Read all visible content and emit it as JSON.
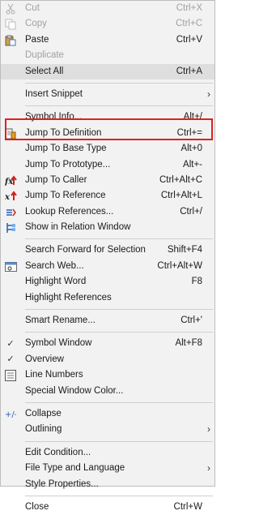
{
  "menu": {
    "cut": {
      "label": "Cut",
      "shortcut": "Ctrl+X",
      "icon": "scissors-icon"
    },
    "copy": {
      "label": "Copy",
      "shortcut": "Ctrl+C",
      "icon": "copy-icon"
    },
    "paste": {
      "label": "Paste",
      "shortcut": "Ctrl+V",
      "icon": "paste-icon"
    },
    "duplicate": {
      "label": "Duplicate",
      "shortcut": ""
    },
    "select_all": {
      "label": "Select All",
      "shortcut": "Ctrl+A"
    },
    "insert_snippet": {
      "label": "Insert Snippet",
      "submenu": "›"
    },
    "symbol_info": {
      "label": "Symbol Info...",
      "shortcut": "Alt+/"
    },
    "jump_definition": {
      "label": "Jump To Definition",
      "shortcut": "Ctrl+=",
      "icon": "jump-definition-icon"
    },
    "jump_base": {
      "label": "Jump To Base Type",
      "shortcut": "Alt+0"
    },
    "jump_prototype": {
      "label": "Jump To Prototype...",
      "shortcut": "Alt+-"
    },
    "jump_caller": {
      "label": "Jump To Caller",
      "shortcut": "Ctrl+Alt+C",
      "icon": "jump-caller-icon"
    },
    "jump_reference": {
      "label": "Jump To Reference",
      "shortcut": "Ctrl+Alt+L",
      "icon": "jump-reference-icon"
    },
    "lookup_refs": {
      "label": "Lookup References...",
      "shortcut": "Ctrl+/",
      "icon": "lookup-references-icon"
    },
    "relation_window": {
      "label": "Show in Relation Window",
      "shortcut": "",
      "icon": "relation-window-icon"
    },
    "search_forward": {
      "label": "Search Forward for Selection",
      "shortcut": "Shift+F4"
    },
    "search_web": {
      "label": "Search Web...",
      "shortcut": "Ctrl+Alt+W",
      "icon": "search-web-icon"
    },
    "highlight_word": {
      "label": "Highlight Word",
      "shortcut": "F8"
    },
    "highlight_refs": {
      "label": "Highlight References",
      "shortcut": ""
    },
    "smart_rename": {
      "label": "Smart Rename...",
      "shortcut": "Ctrl+'"
    },
    "symbol_window": {
      "label": "Symbol Window",
      "shortcut": "Alt+F8",
      "check": "✓"
    },
    "overview": {
      "label": "Overview",
      "shortcut": "",
      "check": "✓"
    },
    "line_numbers": {
      "label": "Line Numbers",
      "shortcut": "",
      "icon": "line-numbers-icon"
    },
    "special_color": {
      "label": "Special Window Color...",
      "shortcut": ""
    },
    "collapse": {
      "label": "Collapse",
      "shortcut": "",
      "icon": "collapse-icon"
    },
    "outlining": {
      "label": "Outlining",
      "submenu": "›"
    },
    "edit_condition": {
      "label": "Edit Condition...",
      "shortcut": ""
    },
    "file_type": {
      "label": "File Type and Language",
      "submenu": "›"
    },
    "style_props": {
      "label": "Style Properties...",
      "shortcut": ""
    },
    "close": {
      "label": "Close",
      "shortcut": "Ctrl+W"
    }
  },
  "colors": {
    "highlight_box": "#e02020",
    "menu_bg": "#f2f2f2",
    "disabled_text": "#a0a0a0"
  }
}
